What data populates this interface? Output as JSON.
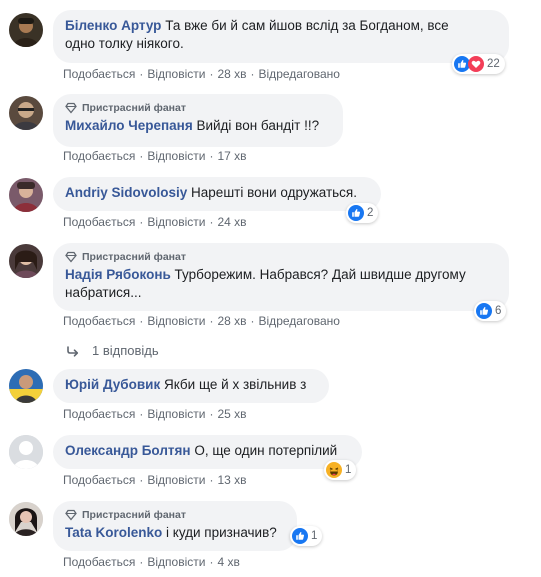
{
  "labels": {
    "like": "Подобається",
    "reply": "Відповісти",
    "edited": "Відредаговано",
    "fan_badge": "Пристрасний фанат",
    "replies_link": "1 відповідь"
  },
  "comments": [
    {
      "author": "Біленко Артур",
      "text1": "Та вже би й сам йшов вслід за Богданом, все",
      "text2": "одно толку ніякого.",
      "time": "28 хв",
      "edited": true,
      "reactions": {
        "types": [
          "like",
          "love"
        ],
        "count": "22"
      }
    },
    {
      "badge": true,
      "author": "Михайло Черепаня",
      "text1": "Вийді вон бандіт !!?",
      "time": "17 хв"
    },
    {
      "author": "Andriy Sidovolosiy",
      "text1": "Нарешті вони одружаться.",
      "time": "24 хв",
      "reactions": {
        "types": [
          "like"
        ],
        "count": "2"
      }
    },
    {
      "badge": true,
      "author": "Надія Рябоконь",
      "text1": "Турборежим. Набрався? Дай швидше другому",
      "text2": "набратися...",
      "time": "28 хв",
      "edited": true,
      "reactions": {
        "types": [
          "like"
        ],
        "count": "6"
      }
    },
    {
      "author": "Юрій Дубовик",
      "text1": "Якби ще й х звільнив з",
      "time": "25 хв"
    },
    {
      "author": "Олександр Болтян",
      "text1": "О, ще один потерпілий",
      "time": "13 хв",
      "reactions": {
        "types": [
          "haha"
        ],
        "count": "1"
      }
    },
    {
      "badge": true,
      "author": "Tata Korolenko",
      "text1": "і куди призначив?",
      "time": "4 хв",
      "reactions": {
        "types": [
          "like"
        ],
        "count": "1"
      }
    }
  ],
  "colors": {
    "author": "#385898",
    "meta": "#606770",
    "bubble": "#f2f3f5",
    "like": "#1877f2",
    "love": "#f33e58",
    "haha": "#f7b125"
  }
}
